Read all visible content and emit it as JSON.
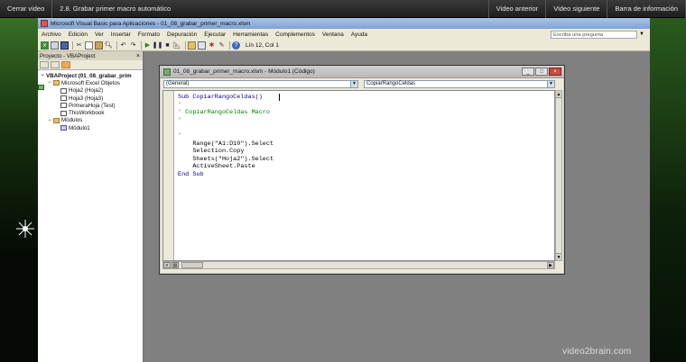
{
  "player": {
    "close_label": "Cerrar video",
    "lesson_title": "2.8.  Grabar primer macro automático",
    "prev_label": "Video anterior",
    "next_label": "Video siguiente",
    "info_label": "Barra de información"
  },
  "app": {
    "title": "Microsoft Visual Basic para Aplicaciones - 01_08_grabar_primer_macro.xlsm",
    "menu": [
      "Archivo",
      "Edición",
      "Ver",
      "Insertar",
      "Formato",
      "Depuración",
      "Ejecutar",
      "Herramientas",
      "Complementos",
      "Ventana",
      "Ayuda"
    ],
    "help_placeholder": "Escriba una pregunta",
    "line_col": "Lín 12, Col 1"
  },
  "project": {
    "title": "Proyecto - VBAProject",
    "close": "×",
    "tree": [
      {
        "label": "VBAProject (01_08_grabar_prim",
        "level": 0,
        "icon": "proj",
        "toggle": "−"
      },
      {
        "label": "Microsoft Excel Objetos",
        "level": 1,
        "icon": "folder",
        "toggle": "−"
      },
      {
        "label": "Hoja2 (Hoja2)",
        "level": 2,
        "icon": "sheet",
        "toggle": ""
      },
      {
        "label": "Hoja3 (Hoja3)",
        "level": 2,
        "icon": "sheet",
        "toggle": ""
      },
      {
        "label": "PrimeraHoja (Test)",
        "level": 2,
        "icon": "sheet",
        "toggle": ""
      },
      {
        "label": "ThisWorkbook",
        "level": 2,
        "icon": "sheet",
        "toggle": ""
      },
      {
        "label": "Módulos",
        "level": 1,
        "icon": "folder",
        "toggle": "−"
      },
      {
        "label": "Módulo1",
        "level": 2,
        "icon": "mod",
        "toggle": ""
      }
    ]
  },
  "codewin": {
    "title": "01_08_grabar_primer_macro.xlsm - Módulo1 (Código)",
    "object_combo": "(General)",
    "proc_combo": "CopiarRangoCeldas",
    "code": [
      {
        "text": "Sub CopiarRangoCeldas()",
        "style": "k"
      },
      {
        "text": "'",
        "style": "c"
      },
      {
        "text": "' CopiarRangoCeldas Macro",
        "style": "c"
      },
      {
        "text": "'",
        "style": "c"
      },
      {
        "text": "",
        "style": ""
      },
      {
        "text": "'",
        "style": "c"
      },
      {
        "text": "    Range(\"A1:D10\").Select",
        "style": ""
      },
      {
        "text": "    Selection.Copy",
        "style": ""
      },
      {
        "text": "    Sheets(\"Hoja2\").Select",
        "style": ""
      },
      {
        "text": "    ActiveSheet.Paste",
        "style": ""
      },
      {
        "text": "End Sub",
        "style": "k"
      }
    ]
  },
  "brand": "video2brain.com"
}
